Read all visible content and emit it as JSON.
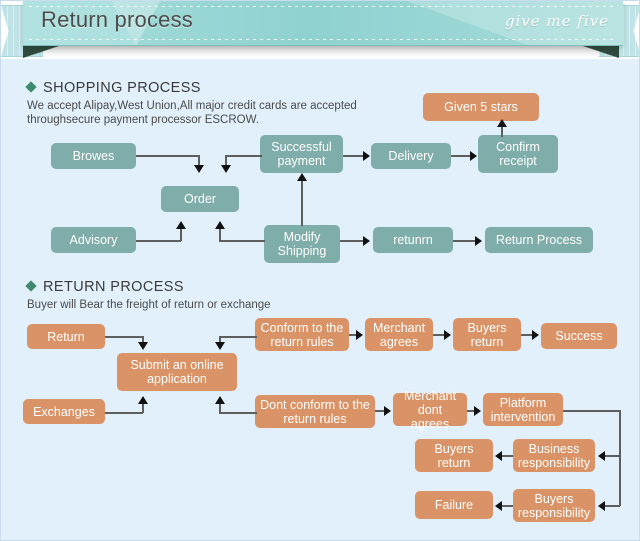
{
  "banner": {
    "title": "Return process",
    "script": "give me five"
  },
  "shopping": {
    "heading": "SHOPPING PROCESS",
    "subtitle_line1": "We accept Alipay,West Union,All major credit cards are accepted",
    "subtitle_line2": "throughsecure payment processor ESCROW.",
    "boxes": [
      {
        "id": "browes",
        "label": "Browes",
        "color": "teal"
      },
      {
        "id": "order",
        "label": "Order",
        "color": "teal"
      },
      {
        "id": "advisory",
        "label": "Advisory",
        "color": "teal"
      },
      {
        "id": "modify-shipping",
        "label": "Modify Shipping",
        "color": "teal"
      },
      {
        "id": "successful-payment",
        "label": "Successful payment",
        "color": "teal"
      },
      {
        "id": "delivery",
        "label": "Delivery",
        "color": "teal"
      },
      {
        "id": "confirm-receipt",
        "label": "Confirm receipt",
        "color": "teal"
      },
      {
        "id": "given-5-stars",
        "label": "Given 5 stars",
        "color": "orange"
      },
      {
        "id": "retunrn",
        "label": "retunrn",
        "color": "teal"
      },
      {
        "id": "return-process",
        "label": "Return Process",
        "color": "teal"
      }
    ]
  },
  "returns": {
    "heading": "RETURN PROCESS",
    "subtitle": "Buyer will Bear the freight of return or exchange",
    "boxes": [
      {
        "id": "return",
        "label": "Return",
        "color": "orange"
      },
      {
        "id": "exchanges",
        "label": "Exchanges",
        "color": "orange"
      },
      {
        "id": "submit-application",
        "label": "Submit an online application",
        "color": "orange"
      },
      {
        "id": "conform-rules",
        "label": "Conform to the return rules",
        "color": "orange"
      },
      {
        "id": "merchant-agrees",
        "label": "Merchant agrees",
        "color": "orange"
      },
      {
        "id": "buyers-return-top",
        "label": "Buyers return",
        "color": "orange"
      },
      {
        "id": "success",
        "label": "Success",
        "color": "orange"
      },
      {
        "id": "dont-conform-rules",
        "label": "Dont conform to the return rules",
        "color": "orange"
      },
      {
        "id": "merchant-dont-agrees",
        "label": "Merchant dont agrees",
        "color": "orange"
      },
      {
        "id": "platform-intervention",
        "label": "Platform intervention",
        "color": "orange"
      },
      {
        "id": "business-responsibility",
        "label": "Business responsibility",
        "color": "orange"
      },
      {
        "id": "buyers-return-bottom",
        "label": "Buyers return",
        "color": "orange"
      },
      {
        "id": "buyers-responsibility",
        "label": "Buyers responsibility",
        "color": "orange"
      },
      {
        "id": "failure",
        "label": "Failure",
        "color": "orange"
      }
    ]
  },
  "colors": {
    "page_background": "#e1f0fb",
    "banner_teal": "#9fd9d6",
    "box_teal": "#7fada9",
    "box_orange": "#da9366",
    "diamond_green": "#3f8a6e",
    "connector": "#5e5e5e"
  }
}
